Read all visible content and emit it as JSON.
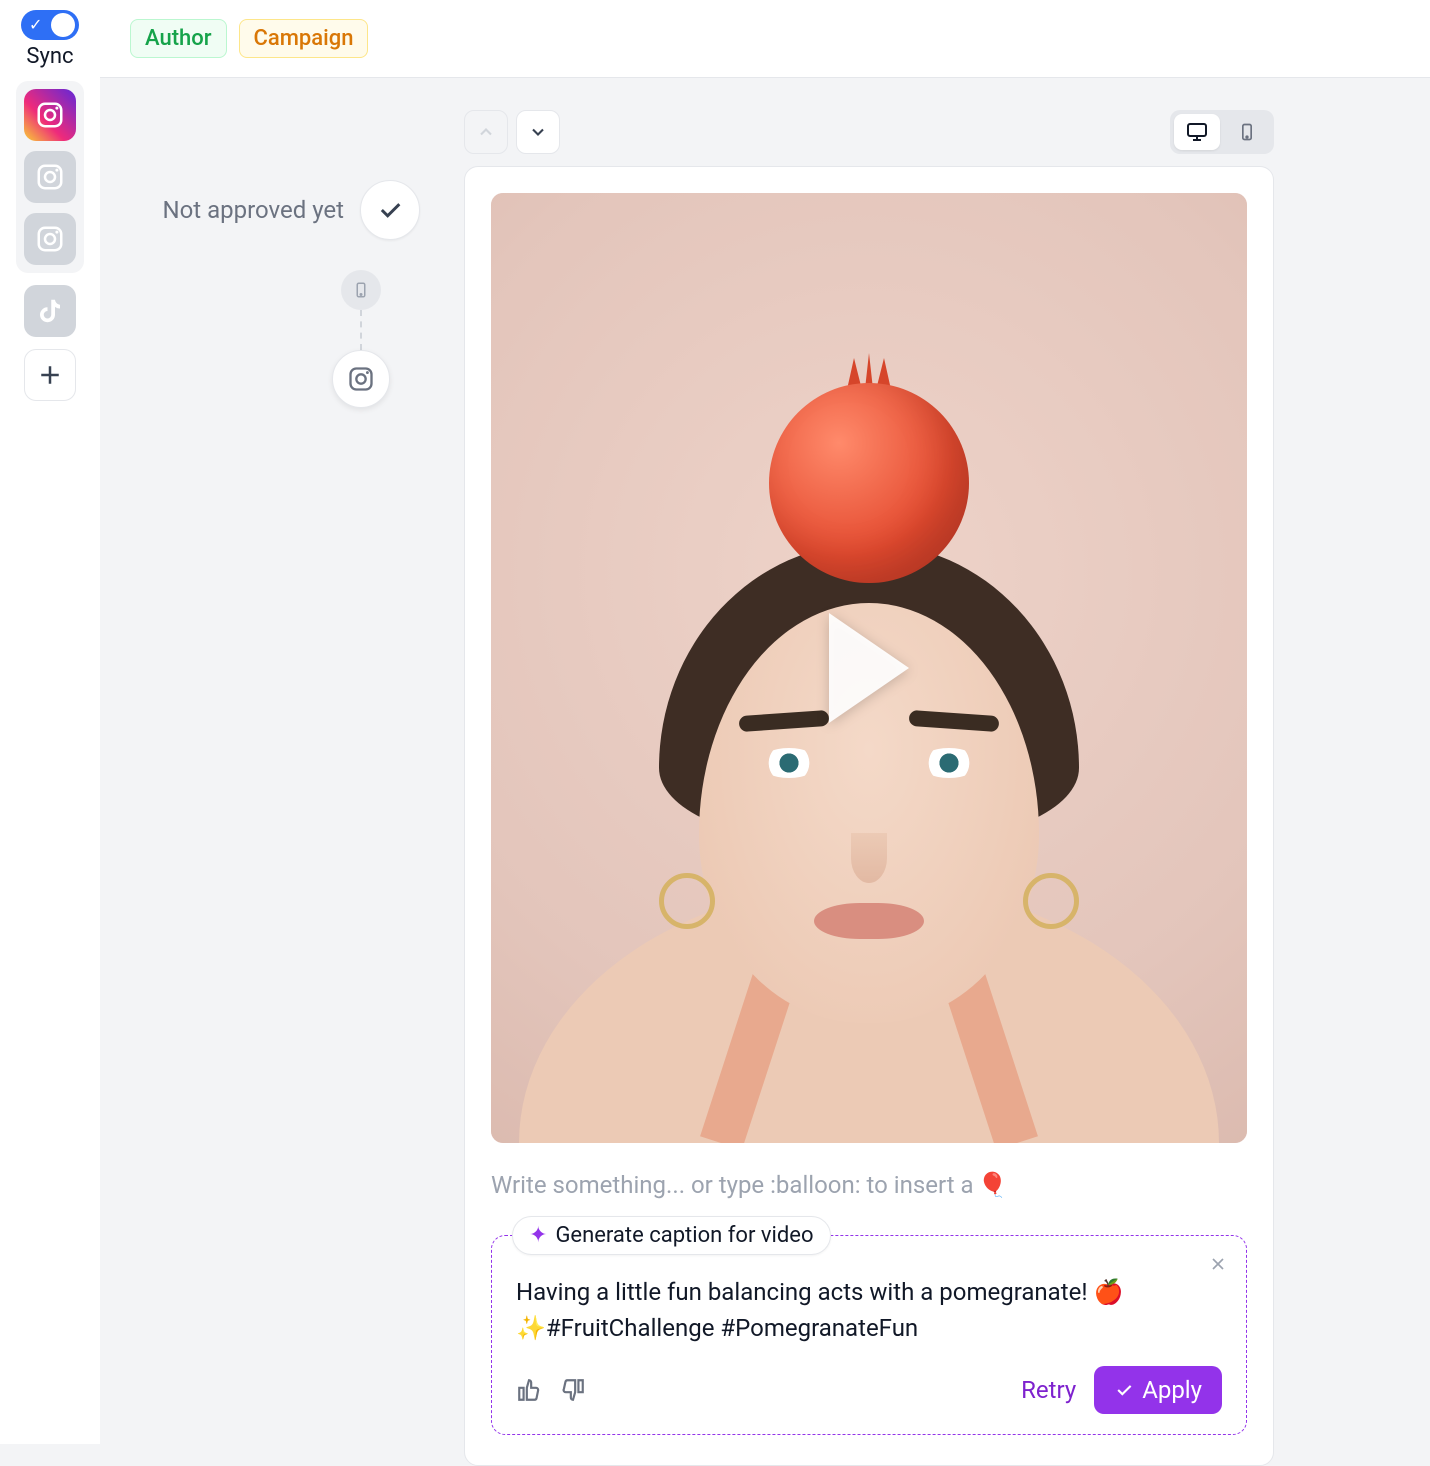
{
  "rail": {
    "sync_label": "Sync",
    "accounts": [
      {
        "type": "instagram",
        "active": true
      },
      {
        "type": "instagram",
        "active": false
      },
      {
        "type": "instagram",
        "active": false
      }
    ],
    "extra_account": {
      "type": "tiktok"
    },
    "add_label": "+"
  },
  "topbar": {
    "tags": [
      {
        "name": "author",
        "label": "Author"
      },
      {
        "name": "campaign",
        "label": "Campaign"
      }
    ]
  },
  "approval": {
    "status_text": "Not approved yet"
  },
  "device": {
    "selected": "desktop"
  },
  "caption_input": {
    "placeholder": "Write something... or type :balloon: to insert a",
    "emoji": "🎈"
  },
  "ai": {
    "chip_label": "Generate caption for video",
    "suggestion": "Having a little fun balancing acts with a pomegranate! 🍎✨#FruitChallenge #PomegranateFun",
    "retry_label": "Retry",
    "apply_label": "Apply"
  }
}
